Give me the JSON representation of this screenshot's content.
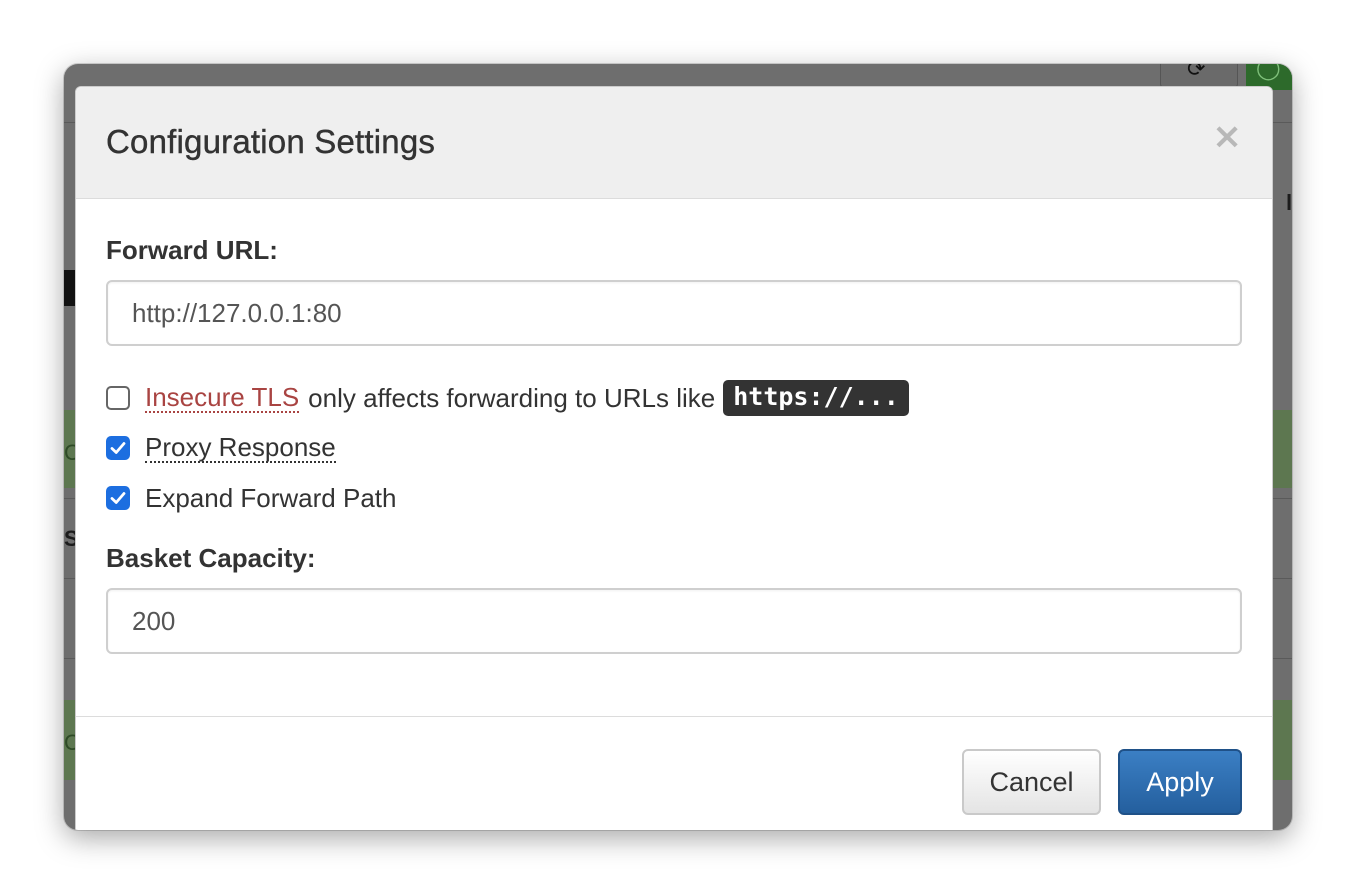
{
  "modal": {
    "title": "Configuration Settings",
    "close_glyph": "×"
  },
  "forward_url": {
    "label": "Forward URL:",
    "value": "http://127.0.0.1:80"
  },
  "options": {
    "insecure_tls": {
      "checked": false,
      "label": "Insecure TLS",
      "note": "only affects forwarding to URLs like",
      "code": "https://..."
    },
    "proxy_response": {
      "checked": true,
      "label": "Proxy Response"
    },
    "expand_forward_path": {
      "checked": true,
      "label": "Expand Forward Path"
    }
  },
  "basket_capacity": {
    "label": "Basket Capacity:",
    "value": "200"
  },
  "footer": {
    "cancel_label": "Cancel",
    "apply_label": "Apply"
  },
  "colors": {
    "accent": "#1c6ee0",
    "apply_button": "#2a6aad",
    "warning_text": "#a94442",
    "backdrop": "#6e6e6e"
  },
  "icons": {
    "refresh": "refresh-icon",
    "close": "close-icon",
    "check": "checkmark-icon"
  }
}
